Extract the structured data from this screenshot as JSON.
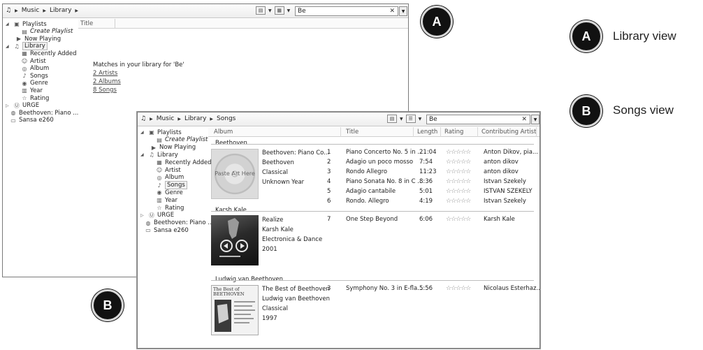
{
  "windowA": {
    "breadcrumb": [
      "Music",
      "Library"
    ],
    "search_value": "Be",
    "col_title": "Title",
    "nav": [
      {
        "label": "Playlists",
        "icon": "playlist-icon"
      },
      {
        "label": "Create Playlist",
        "icon": "new-playlist-icon"
      },
      {
        "label": "Now Playing",
        "icon": "now-playing-icon"
      },
      {
        "label": "Library",
        "icon": "music-note-icon"
      },
      {
        "label": "Recently Added",
        "icon": "calendar-icon"
      },
      {
        "label": "Artist",
        "icon": "artist-icon"
      },
      {
        "label": "Album",
        "icon": "album-icon"
      },
      {
        "label": "Songs",
        "icon": "song-note-icon"
      },
      {
        "label": "Genre",
        "icon": "genre-icon"
      },
      {
        "label": "Year",
        "icon": "year-icon"
      },
      {
        "label": "Rating",
        "icon": "star-icon"
      },
      {
        "label": "URGE",
        "icon": "urge-icon"
      },
      {
        "label": "Beethoven: Piano ...",
        "icon": "disc-icon"
      },
      {
        "label": "Sansa e260",
        "icon": "device-icon"
      }
    ],
    "matches_heading": "Matches in your library for 'Be'",
    "matches": [
      "2 Artists",
      "2 Albums",
      "8 Songs"
    ]
  },
  "windowB": {
    "breadcrumb": [
      "Music",
      "Library",
      "Songs"
    ],
    "search_value": "Be",
    "columns": [
      "Album",
      "Title",
      "Length",
      "Rating",
      "Contributing Artist"
    ],
    "nav": [
      {
        "label": "Playlists",
        "icon": "playlist-icon"
      },
      {
        "label": "Create Playlist",
        "icon": "new-playlist-icon"
      },
      {
        "label": "Now Playing",
        "icon": "now-playing-icon"
      },
      {
        "label": "Library",
        "icon": "music-note-icon"
      },
      {
        "label": "Recently Added",
        "icon": "calendar-icon"
      },
      {
        "label": "Artist",
        "icon": "artist-icon"
      },
      {
        "label": "Album",
        "icon": "album-icon"
      },
      {
        "label": "Songs",
        "icon": "song-note-icon"
      },
      {
        "label": "Genre",
        "icon": "genre-icon"
      },
      {
        "label": "Year",
        "icon": "year-icon"
      },
      {
        "label": "Rating",
        "icon": "star-icon"
      },
      {
        "label": "URGE",
        "icon": "urge-icon"
      },
      {
        "label": "Beethoven: Piano ...",
        "icon": "disc-icon"
      },
      {
        "label": "Sansa e260",
        "icon": "device-icon"
      }
    ],
    "groups": [
      {
        "artist": "Beethoven",
        "art_text": "Paste Art Here",
        "album": [
          "Beethoven: Piano Co...",
          "Beethoven",
          "Classical",
          "Unknown Year"
        ],
        "tracks": [
          {
            "no": "1",
            "title": "Piano Concerto No. 5 in ...",
            "length": "21:04",
            "rating": 0,
            "artist": "Anton Dikov, pia..."
          },
          {
            "no": "2",
            "title": "Adagio un poco mosso",
            "length": "7:54",
            "rating": 0,
            "artist": "anton dikov"
          },
          {
            "no": "3",
            "title": "Rondo Allegro",
            "length": "11:23",
            "rating": 0,
            "artist": "anton dikov"
          },
          {
            "no": "4",
            "title": "Piano Sonata No. 8 in C ...",
            "length": "8:36",
            "rating": 0,
            "artist": "Istvan Szekely"
          },
          {
            "no": "5",
            "title": "Adagio cantabile",
            "length": "5:01",
            "rating": 0,
            "artist": "ISTVAN SZEKELY"
          },
          {
            "no": "6",
            "title": "Rondo. Allegro",
            "length": "4:19",
            "rating": 0,
            "artist": "Istvan Szekely"
          }
        ]
      },
      {
        "artist": "Karsh Kale",
        "album": [
          "Realize",
          "Karsh Kale",
          "Electronica & Dance",
          "2001"
        ],
        "tracks": [
          {
            "no": "7",
            "title": "One Step Beyond",
            "length": "6:06",
            "rating": 0,
            "artist": "Karsh Kale"
          }
        ]
      },
      {
        "artist": "Ludwig van Beethoven",
        "art_text": "The Best of BEETHOVEN",
        "album": [
          "The Best of Beethoven",
          "Ludwig van Beethoven",
          "Classical",
          "1997"
        ],
        "tracks": [
          {
            "no": "3",
            "title": "Symphony No. 3 in E-fla...",
            "length": "5:56",
            "rating": 0,
            "artist": "Nicolaus Esterhaz..."
          }
        ]
      }
    ]
  },
  "callouts": {
    "a_letter": "A",
    "b_letter": "B",
    "a_label": "Library view",
    "b_label": "Songs view"
  }
}
